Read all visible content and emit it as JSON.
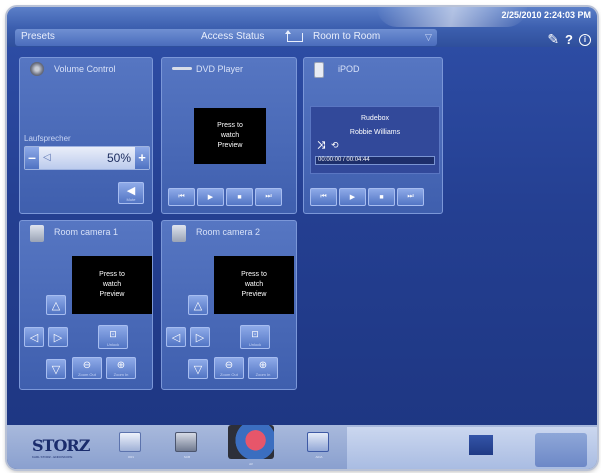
{
  "header": {
    "datetime": "2/25/2010 2:24:03 PM",
    "presets_label": "Presets",
    "access_status_label": "Access Status",
    "room_to_room_label": "Room to Room",
    "icons": [
      "wrench-icon",
      "help-icon",
      "info-icon"
    ]
  },
  "volume": {
    "title": "Volume Control",
    "output_label": "Laufsprecher",
    "value": "50%",
    "minus": "–",
    "plus": "+",
    "mute_label": "Mute"
  },
  "dvd": {
    "title": "DVD Player",
    "preview_text": "Press to watch Preview"
  },
  "ipod": {
    "title": "iPOD",
    "track": "Rudebox",
    "artist": "Robbie Williams",
    "time": "00:00:00 / 00:04:44"
  },
  "camera1": {
    "title": "Room camera 1",
    "preview_text": "Press to watch Preview",
    "unlock_label": "Unlock",
    "zoom_out_label": "Zoom Out",
    "zoom_in_label": "Zoom In"
  },
  "camera2": {
    "title": "Room camera 2",
    "preview_text": "Press to watch Preview",
    "unlock_label": "Unlock",
    "zoom_out_label": "Zoom Out",
    "zoom_in_label": "Zoom In"
  },
  "transport_glyphs": {
    "prev": "⏮",
    "play": "▶",
    "stop": "■",
    "next": "⏭"
  },
  "dock": {
    "brand": "STORZ",
    "brand_sub": "KARL STORZ - ENDOSKOPE",
    "items": [
      "OR1",
      "SCB",
      "AV",
      "AIDA"
    ]
  },
  "colors": {
    "background": "#243f91",
    "panel": "#4a6ab8",
    "accent": "#8eaae8"
  }
}
